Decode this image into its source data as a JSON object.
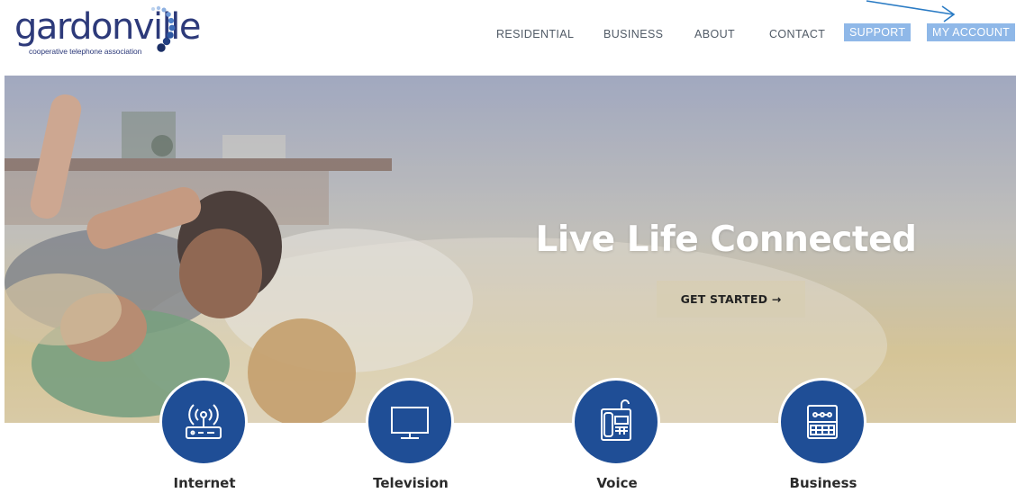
{
  "logo": {
    "wordmark": "gardonville",
    "tagline": "cooperative telephone association",
    "brand_color": "#2d3a7a"
  },
  "nav": {
    "items": [
      "RESIDENTIAL",
      "BUSINESS",
      "ABOUT",
      "CONTACT"
    ],
    "support_label": "SUPPORT",
    "account_label": "MY ACCOUNT",
    "button_color": "#8fb8e8"
  },
  "hero": {
    "title": "Live Life Connected",
    "cta_label": "GET STARTED →"
  },
  "services": [
    {
      "label": "Internet",
      "icon": "router-icon"
    },
    {
      "label": "Television",
      "icon": "tv-icon"
    },
    {
      "label": "Voice",
      "icon": "desk-phone-icon"
    },
    {
      "label": "Business",
      "icon": "business-device-icon"
    }
  ],
  "accent_color": "#1f4e96"
}
